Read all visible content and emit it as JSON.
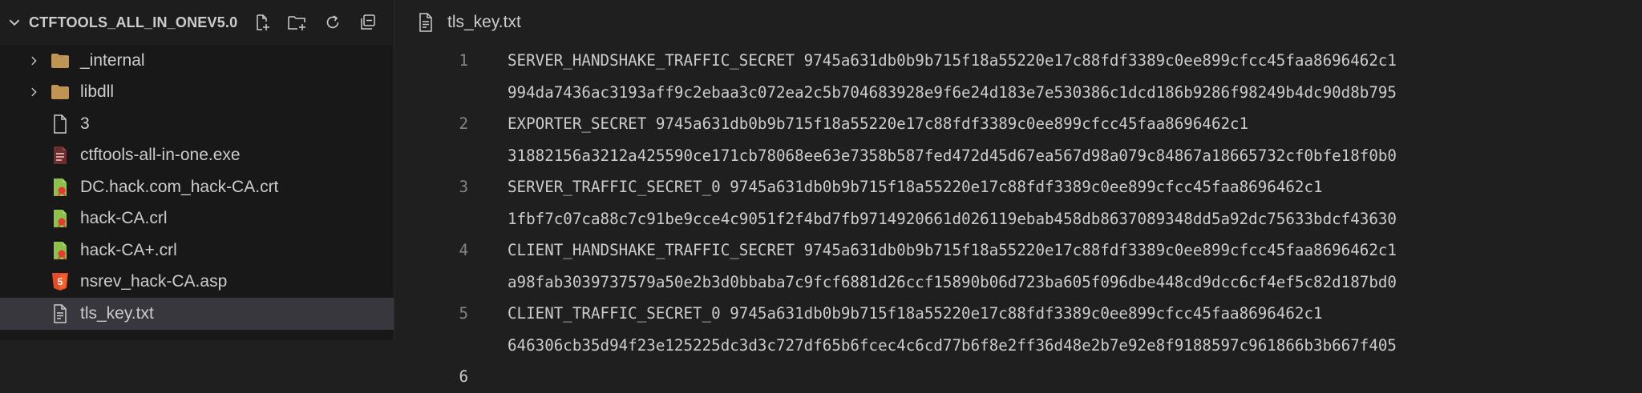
{
  "explorer": {
    "title": "CTFTOOLS_ALL_IN_ONEV5.0",
    "actions": [
      {
        "name": "new-file-icon"
      },
      {
        "name": "new-folder-icon"
      },
      {
        "name": "refresh-icon"
      },
      {
        "name": "collapse-all-icon"
      }
    ],
    "items": [
      {
        "label": "_internal",
        "type": "folder",
        "icon": "folder-icon"
      },
      {
        "label": "libdll",
        "type": "folder",
        "icon": "folder-icon"
      },
      {
        "label": "3",
        "type": "file",
        "icon": "file-icon"
      },
      {
        "label": "ctftools-all-in-one.exe",
        "type": "file",
        "icon": "exe-file-icon"
      },
      {
        "label": "DC.hack.com_hack-CA.crt",
        "type": "file",
        "icon": "certificate-file-icon"
      },
      {
        "label": "hack-CA.crl",
        "type": "file",
        "icon": "certificate-file-icon"
      },
      {
        "label": "hack-CA+.crl",
        "type": "file",
        "icon": "certificate-file-icon"
      },
      {
        "label": "nsrev_hack-CA.asp",
        "type": "file",
        "icon": "html5-file-icon"
      },
      {
        "label": "tls_key.txt",
        "type": "file",
        "icon": "text-file-icon",
        "selected": true
      }
    ]
  },
  "editor": {
    "tab": {
      "label": "tls_key.txt"
    },
    "lines": [
      {
        "number": "1",
        "parts": [
          "SERVER_HANDSHAKE_TRAFFIC_SECRET 9745a631db0b9b715f18a55220e17c88fdf3389c0ee899cfcc45faa8696462c1",
          "994da7436ac3193aff9c2ebaa3c072ea2c5b704683928e9f6e24d183e7e530386c1dcd186b9286f98249b4dc90d8b795"
        ]
      },
      {
        "number": "2",
        "parts": [
          "EXPORTER_SECRET 9745a631db0b9b715f18a55220e17c88fdf3389c0ee899cfcc45faa8696462c1",
          "31882156a3212a425590ce171cb78068ee63e7358b587fed472d45d67ea567d98a079c84867a18665732cf0bfe18f0b0"
        ]
      },
      {
        "number": "3",
        "parts": [
          "SERVER_TRAFFIC_SECRET_0 9745a631db0b9b715f18a55220e17c88fdf3389c0ee899cfcc45faa8696462c1",
          "1fbf7c07ca88c7c91be9cce4c9051f2f4bd7fb9714920661d026119ebab458db8637089348dd5a92dc75633bdcf43630"
        ]
      },
      {
        "number": "4",
        "parts": [
          "CLIENT_HANDSHAKE_TRAFFIC_SECRET 9745a631db0b9b715f18a55220e17c88fdf3389c0ee899cfcc45faa8696462c1",
          "a98fab3039737579a50e2b3d0bbaba7c9fcf6881d26ccf15890b06d723ba605f096dbe448cd9dcc6cf4ef5c82d187bd0"
        ]
      },
      {
        "number": "5",
        "parts": [
          "CLIENT_TRAFFIC_SECRET_0 9745a631db0b9b715f18a55220e17c88fdf3389c0ee899cfcc45faa8696462c1",
          "646306cb35d94f23e125225dc3d3c727df65b6fcec4c6cd77b6f8e2ff36d48e2b7e92e8f9188597c961866b3b667f405"
        ]
      },
      {
        "number": "6",
        "parts": [
          ""
        ],
        "active": true
      }
    ]
  },
  "colors": {
    "folder": "#c09553",
    "certificate": "#8dc149",
    "certificate_mark": "#e53935",
    "html5": "#e44d26",
    "exe": "#6b2f2f"
  }
}
